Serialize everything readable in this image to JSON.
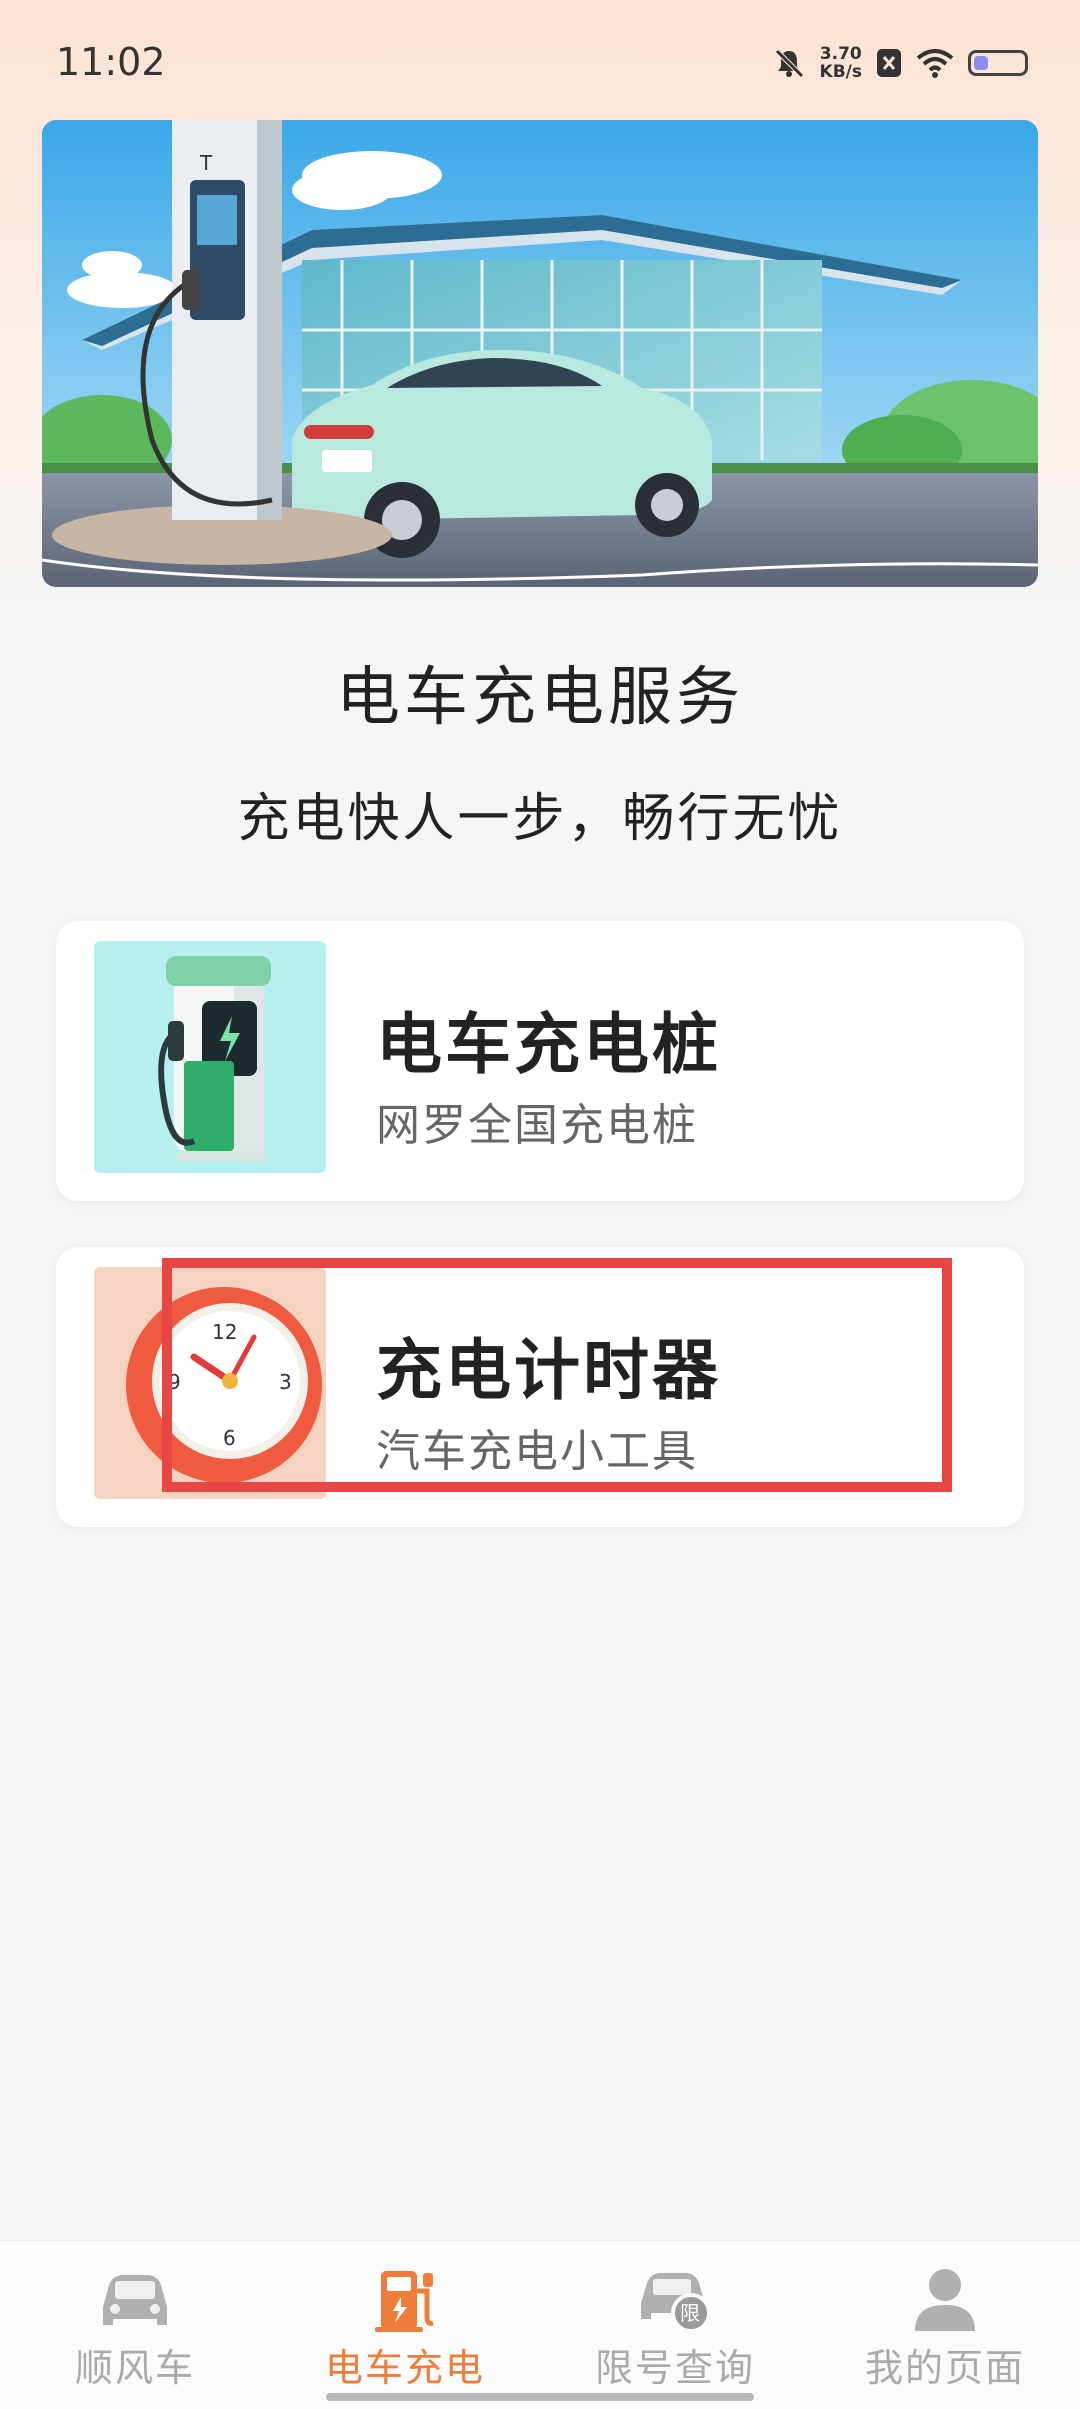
{
  "status_bar": {
    "time": "11:02",
    "speed_value": "3.70",
    "speed_unit": "KB/s",
    "battery_level": 0.3
  },
  "hero": {
    "title": "电车充电服务",
    "subtitle": "充电快人一步，畅行无忧"
  },
  "cards": [
    {
      "title": "电车充电桩",
      "subtitle": "网罗全国充电桩",
      "icon": "charging-pile-icon"
    },
    {
      "title": "充电计时器",
      "subtitle": "汽车充电小工具",
      "icon": "clock-icon"
    }
  ],
  "bottom_nav": {
    "items": [
      {
        "label": "顺风车",
        "icon": "car-icon"
      },
      {
        "label": "电车充电",
        "icon": "charging-station-icon"
      },
      {
        "label": "限号查询",
        "icon": "restricted-car-icon"
      },
      {
        "label": "我的页面",
        "icon": "person-icon"
      }
    ],
    "active_index": 1
  },
  "colors": {
    "accent": "#f07c3a",
    "highlight_border": "#e84545",
    "inactive": "#aaaaaa"
  }
}
